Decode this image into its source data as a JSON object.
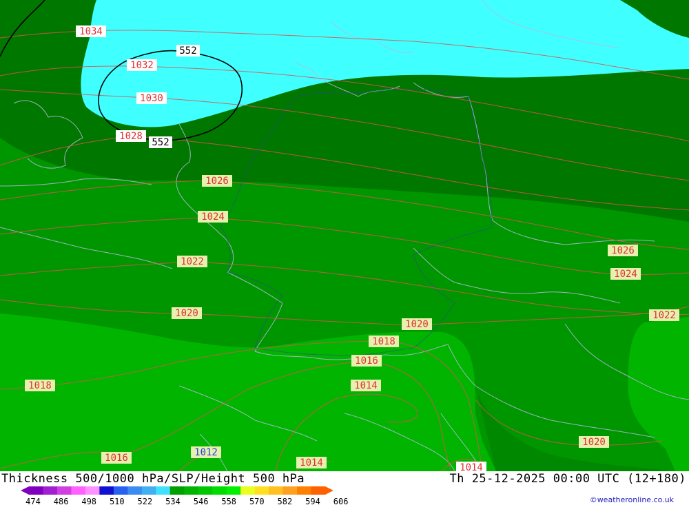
{
  "title": {
    "left": "Thickness 500/1000 hPa/SLP/Height 500 hPa",
    "right": "Th 25-12-2025 00:00 UTC (12+180)"
  },
  "credit": "©weatheronline.co.uk",
  "colors": {
    "thickness_534": "#007800",
    "thickness_546": "#009600",
    "thickness_558": "#00b400",
    "thickness_cyan": "#40ffff",
    "isobar": "#e05050",
    "height_contour": "#000000",
    "borders": "#b8b8e0"
  },
  "scale": {
    "labels": [
      "474",
      "486",
      "498",
      "510",
      "522",
      "534",
      "546",
      "558",
      "570",
      "582",
      "594",
      "606"
    ],
    "colors": [
      "#8000c0",
      "#a020d0",
      "#d040e0",
      "#ff60ff",
      "#ff90ff",
      "#1010d0",
      "#2860f0",
      "#3c8cf0",
      "#40b0f0",
      "#40e0ff",
      "#00a000",
      "#00b400",
      "#00c800",
      "#00dc00",
      "#00f000",
      "#e8ff20",
      "#ffe020",
      "#ffc020",
      "#ffa020",
      "#ff8000",
      "#ff6000"
    ]
  },
  "isobar_labels": [
    "1034",
    "1032",
    "1030",
    "1028",
    "1026",
    "1024",
    "1022",
    "1020",
    "1018",
    "1016",
    "1014",
    "1012",
    "1026",
    "1024",
    "1022",
    "1020",
    "1018",
    "1016",
    "1014",
    "1020",
    "1014",
    "1014",
    "1016",
    "1018"
  ],
  "height_labels": [
    "552",
    "552"
  ]
}
